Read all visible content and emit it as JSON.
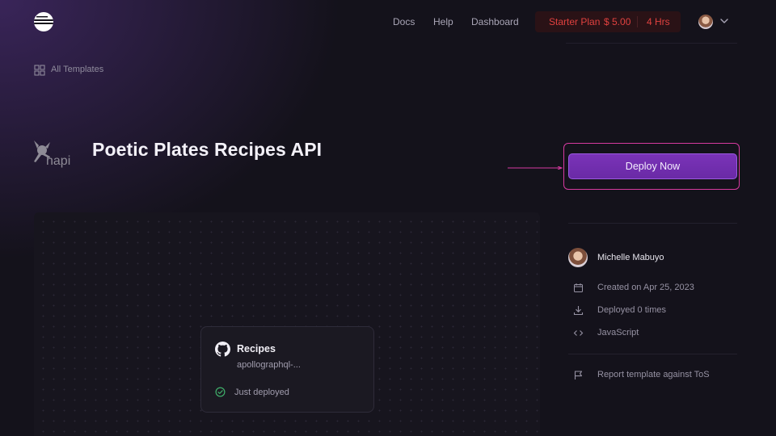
{
  "header": {
    "nav": {
      "docs": "Docs",
      "help": "Help",
      "dashboard": "Dashboard"
    },
    "plan": {
      "name": "Starter Plan",
      "cost": "$ 5.00",
      "hours": "4 Hrs"
    }
  },
  "breadcrumb": {
    "label": "All Templates"
  },
  "template": {
    "logo_text": "hapi",
    "title": "Poetic Plates Recipes API",
    "deploy_label": "Deploy Now"
  },
  "canvas": {
    "service": {
      "name": "Recipes",
      "repo": "apollographql-...",
      "status": "Just deployed"
    }
  },
  "sidebar": {
    "author": "Michelle Mabuyo",
    "created": "Created on Apr 25, 2023",
    "deployed": "Deployed 0 times",
    "language": "JavaScript",
    "report": "Report template against ToS"
  },
  "icons": {
    "logo": "railway-logo-icon",
    "grid": "grid-icon",
    "calendar": "calendar-icon",
    "download": "download-icon",
    "code": "code-icon",
    "flag": "flag-icon",
    "github": "github-icon",
    "check": "check-circle-icon"
  },
  "colors": {
    "accent": "#7a33b8",
    "highlight": "#d63aa0",
    "plan_text": "#e0413f",
    "success": "#3fae6a"
  }
}
